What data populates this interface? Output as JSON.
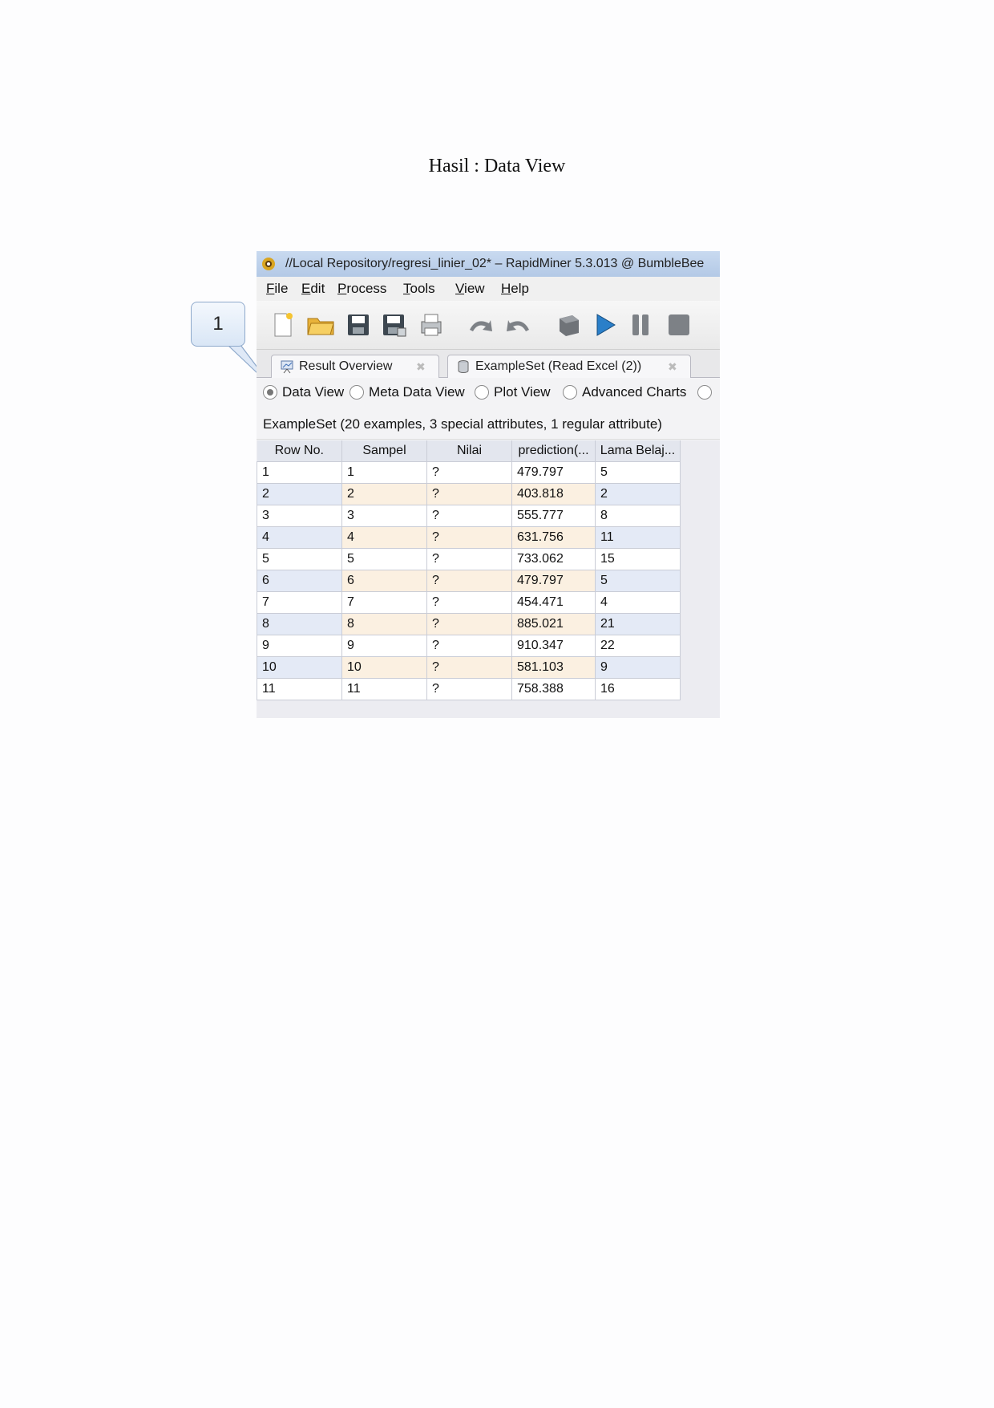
{
  "caption": "Hasil : Data View",
  "callout": {
    "label": "1"
  },
  "window": {
    "title": "//Local Repository/regresi_linier_02* – RapidMiner 5.3.013 @ BumbleBee",
    "menu": [
      "File",
      "Edit",
      "Process",
      "Tools",
      "View",
      "Help"
    ],
    "toolbar_icons": [
      "new-process-icon",
      "open-folder-icon",
      "save-icon",
      "save-as-icon",
      "print-icon",
      "undo-icon",
      "redo-icon",
      "validate-icon",
      "run-icon",
      "pause-icon",
      "stop-icon"
    ],
    "tabs": [
      {
        "label": "Result Overview",
        "icon": "result-overview-icon"
      },
      {
        "label": "ExampleSet (Read Excel (2))",
        "icon": "database-icon"
      }
    ],
    "view_modes": [
      {
        "label": "Data View",
        "selected": true
      },
      {
        "label": "Meta Data View",
        "selected": false
      },
      {
        "label": "Plot View",
        "selected": false
      },
      {
        "label": "Advanced Charts",
        "selected": false
      }
    ],
    "exampleset_info": "ExampleSet (20 examples, 3 special attributes, 1 regular attribute)"
  },
  "table": {
    "columns": [
      "Row No.",
      "Sampel",
      "Nilai",
      "prediction(...",
      "Lama Belaj..."
    ],
    "rows": [
      [
        "1",
        "1",
        "?",
        "479.797",
        "5"
      ],
      [
        "2",
        "2",
        "?",
        "403.818",
        "2"
      ],
      [
        "3",
        "3",
        "?",
        "555.777",
        "8"
      ],
      [
        "4",
        "4",
        "?",
        "631.756",
        "11"
      ],
      [
        "5",
        "5",
        "?",
        "733.062",
        "15"
      ],
      [
        "6",
        "6",
        "?",
        "479.797",
        "5"
      ],
      [
        "7",
        "7",
        "?",
        "454.471",
        "4"
      ],
      [
        "8",
        "8",
        "?",
        "885.021",
        "21"
      ],
      [
        "9",
        "9",
        "?",
        "910.347",
        "22"
      ],
      [
        "10",
        "10",
        "?",
        "581.103",
        "9"
      ],
      [
        "11",
        "11",
        "?",
        "758.388",
        "16"
      ]
    ]
  },
  "colors": {
    "titlebar": "#b3c9e6",
    "row_alt_blue": "#e4eaf6",
    "row_alt_warm": "#fbf0e1",
    "run_blue": "#2a7fc9"
  }
}
